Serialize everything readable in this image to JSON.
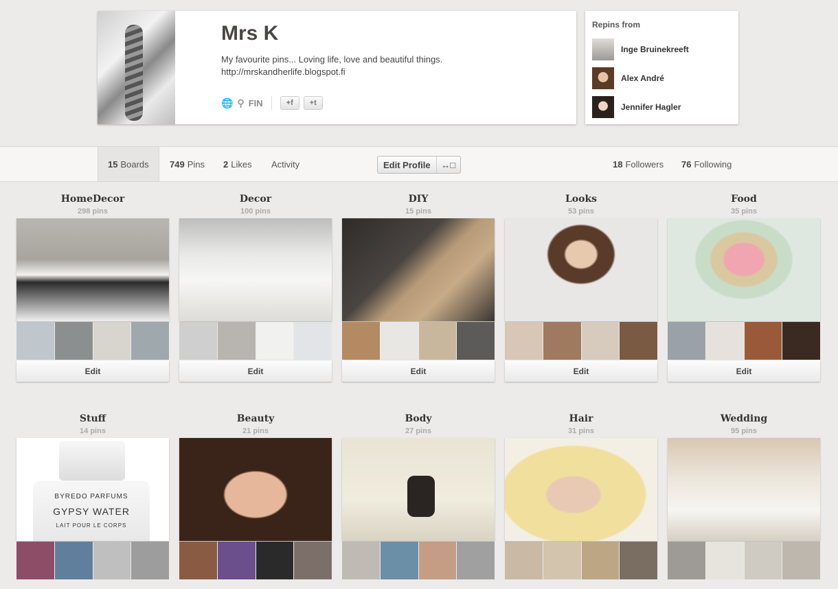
{
  "profile": {
    "name": "Mrs K",
    "description": "My favourite pins... Loving life, love and beautiful things.",
    "url": "http://mrskandherlife.blogspot.fi",
    "location": "FIN",
    "facebook_btn": "+f",
    "twitter_btn": "+t"
  },
  "repins": {
    "title": "Repins from",
    "users": [
      {
        "name": "Inge Bruinekreeft"
      },
      {
        "name": "Alex André"
      },
      {
        "name": "Jennifer Hagler"
      }
    ]
  },
  "nav": {
    "boards_count": "15",
    "boards_label": "Boards",
    "pins_count": "749",
    "pins_label": "Pins",
    "likes_count": "2",
    "likes_label": "Likes",
    "activity_label": "Activity",
    "edit_profile_label": "Edit Profile",
    "followers_count": "18",
    "followers_label": "Followers",
    "following_count": "76",
    "following_label": "Following"
  },
  "boards": [
    {
      "title": "HomeDecor",
      "count": "298 pins",
      "edit": "Edit"
    },
    {
      "title": "Decor",
      "count": "100 pins",
      "edit": "Edit"
    },
    {
      "title": "DIY",
      "count": "15 pins",
      "edit": "Edit"
    },
    {
      "title": "Looks",
      "count": "53 pins",
      "edit": "Edit"
    },
    {
      "title": "Food",
      "count": "35 pins",
      "edit": "Edit"
    },
    {
      "title": "Stuff",
      "count": "14 pins",
      "edit": "Edit"
    },
    {
      "title": "Beauty",
      "count": "21 pins",
      "edit": "Edit"
    },
    {
      "title": "Body",
      "count": "27 pins",
      "edit": "Edit"
    },
    {
      "title": "Hair",
      "count": "31 pins",
      "edit": "Edit"
    },
    {
      "title": "Wedding",
      "count": "95 pins",
      "edit": "Edit"
    }
  ],
  "stuff_cover_text": {
    "brand": "BYREDO PARFUMS",
    "product": "GYPSY WATER",
    "sub": "LAIT POUR LE CORPS"
  }
}
